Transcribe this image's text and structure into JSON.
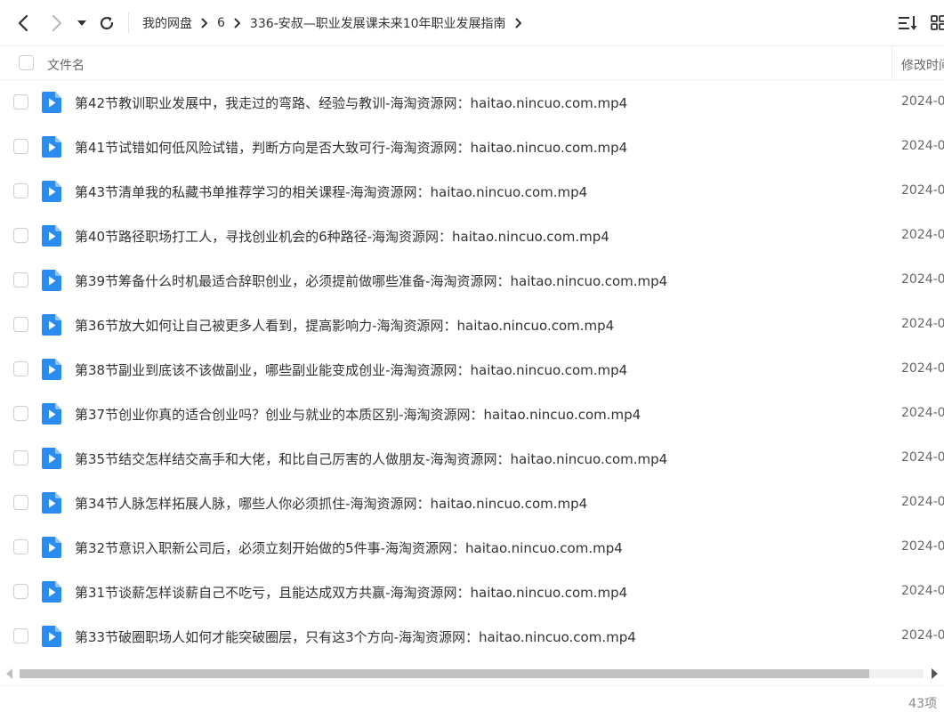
{
  "breadcrumb": [
    "我的网盘",
    "6",
    "336-安叔—职业发展课未来10年职业发展指南"
  ],
  "columns": {
    "name": "文件名",
    "modified": "修改时间"
  },
  "files": [
    {
      "name": "第42节教训职业发展中，我走过的弯路、经验与教训-海淘资源网：haitao.nincuo.com.mp4",
      "modified": "2024-0"
    },
    {
      "name": "第41节试错如何低风险试错，判断方向是否大致可行-海淘资源网：haitao.nincuo.com.mp4",
      "modified": "2024-0"
    },
    {
      "name": "第43节清单我的私藏书单推荐学习的相关课程-海淘资源网：haitao.nincuo.com.mp4",
      "modified": "2024-0"
    },
    {
      "name": "第40节路径职场打工人，寻找创业机会的6种路径-海淘资源网：haitao.nincuo.com.mp4",
      "modified": "2024-0"
    },
    {
      "name": "第39节筹备什么时机最适合辞职创业，必须提前做哪些准备-海淘资源网：haitao.nincuo.com.mp4",
      "modified": "2024-0"
    },
    {
      "name": "第36节放大如何让自己被更多人看到，提高影响力-海淘资源网：haitao.nincuo.com.mp4",
      "modified": "2024-0"
    },
    {
      "name": "第38节副业到底该不该做副业，哪些副业能变成创业-海淘资源网：haitao.nincuo.com.mp4",
      "modified": "2024-0"
    },
    {
      "name": "第37节创业你真的适合创业吗？创业与就业的本质区别-海淘资源网：haitao.nincuo.com.mp4",
      "modified": "2024-0"
    },
    {
      "name": "第35节结交怎样结交高手和大佬，和比自己厉害的人做朋友-海淘资源网：haitao.nincuo.com.mp4",
      "modified": "2024-0"
    },
    {
      "name": "第34节人脉怎样拓展人脉，哪些人你必须抓住-海淘资源网：haitao.nincuo.com.mp4",
      "modified": "2024-0"
    },
    {
      "name": "第32节意识入职新公司后，必须立刻开始做的5件事-海淘资源网：haitao.nincuo.com.mp4",
      "modified": "2024-0"
    },
    {
      "name": "第31节谈薪怎样谈薪自己不吃亏，且能达成双方共赢-海淘资源网：haitao.nincuo.com.mp4",
      "modified": "2024-0"
    },
    {
      "name": "第33节破圈职场人如何才能突破圈层，只有这3个方向-海淘资源网：haitao.nincuo.com.mp4",
      "modified": "2024-0"
    }
  ],
  "scroll_position_fraction": 0.94,
  "item_count": "43项",
  "colors": {
    "accent": "#2b8cf0",
    "text": "#333333",
    "muted": "#666666"
  },
  "icons": {
    "back": "chevron-left-icon",
    "forward": "chevron-right-icon",
    "history": "caret-down-icon",
    "refresh": "refresh-icon",
    "sort": "sort-icon",
    "grid": "grid-view-icon",
    "video": "video-file-icon"
  }
}
